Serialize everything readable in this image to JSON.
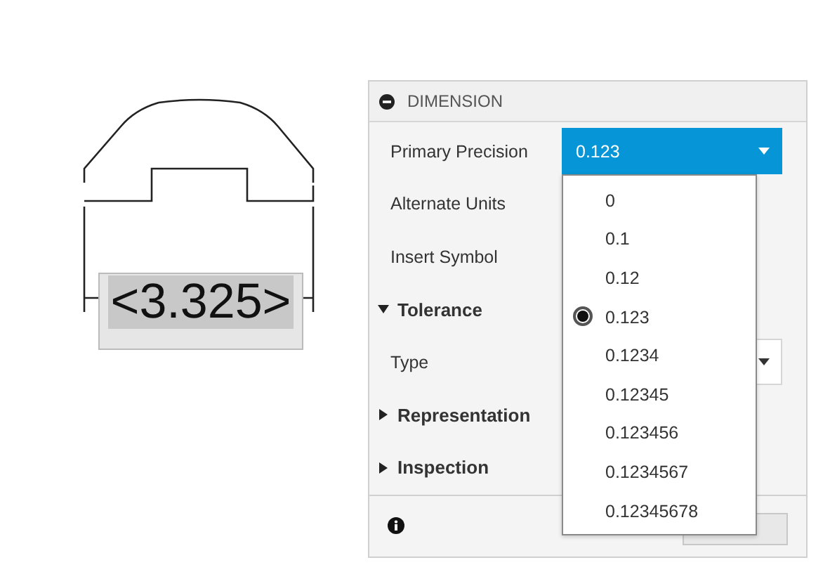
{
  "drawing": {
    "dimension_text": "<3.325>"
  },
  "panel": {
    "title": "DIMENSION",
    "expanded": true,
    "rows": [
      {
        "kind": "select",
        "label": "Primary Precision",
        "value": "0.123",
        "focused": true
      },
      {
        "kind": "label",
        "label": "Alternate Units"
      },
      {
        "kind": "label",
        "label": "Insert Symbol"
      },
      {
        "kind": "group",
        "label": "Tolerance",
        "expanded": true
      },
      {
        "kind": "select",
        "label": "Type",
        "focused": false
      },
      {
        "kind": "group",
        "label": "Representation",
        "expanded": false
      },
      {
        "kind": "group",
        "label": "Inspection",
        "expanded": false
      }
    ],
    "dropdown": {
      "options": [
        {
          "label": "0",
          "selected": false
        },
        {
          "label": "0.1",
          "selected": false
        },
        {
          "label": "0.12",
          "selected": false
        },
        {
          "label": "0.123",
          "selected": true
        },
        {
          "label": "0.1234",
          "selected": false
        },
        {
          "label": "0.12345",
          "selected": false
        },
        {
          "label": "0.123456",
          "selected": false
        },
        {
          "label": "0.1234567",
          "selected": false
        },
        {
          "label": "0.12345678",
          "selected": false
        }
      ]
    }
  }
}
